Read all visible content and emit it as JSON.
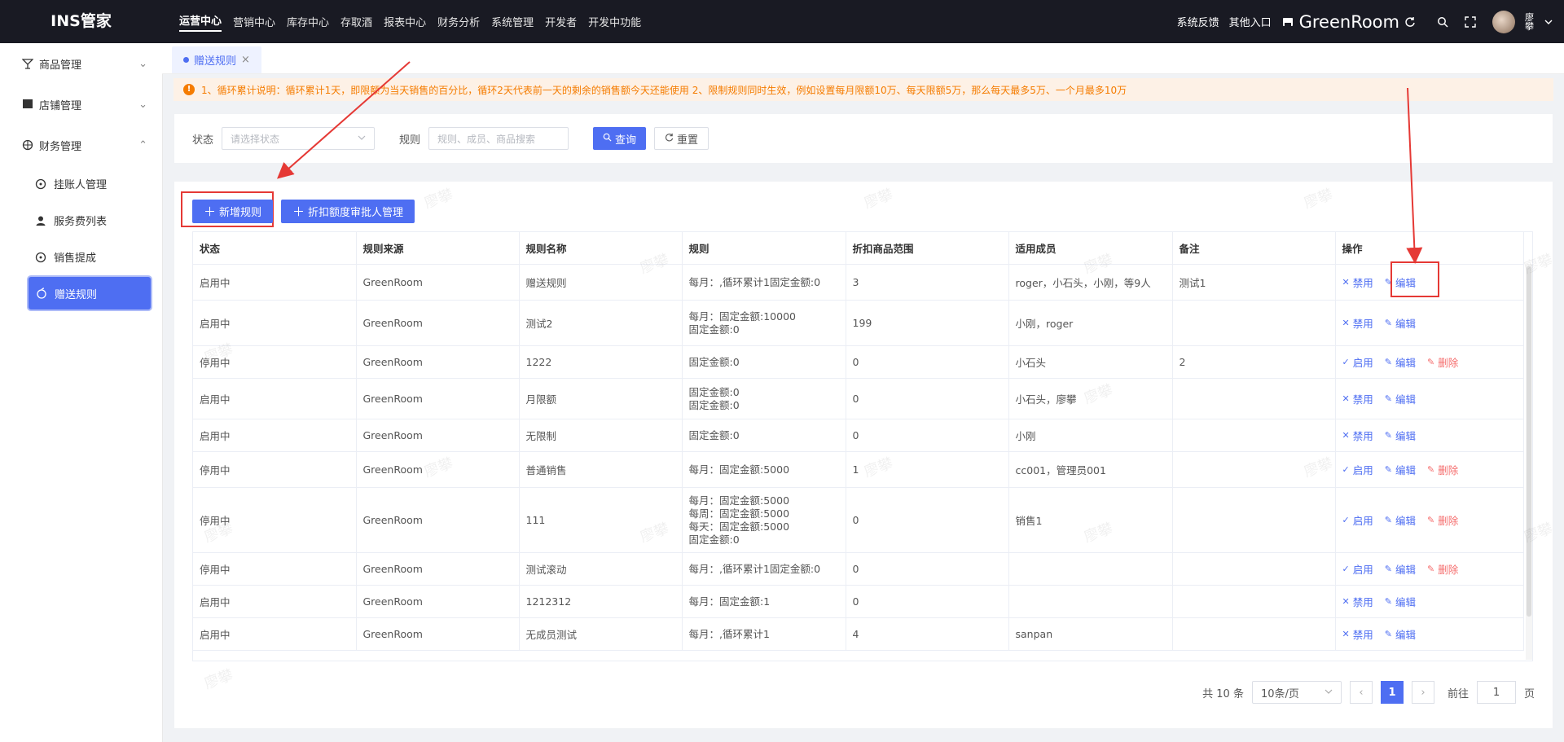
{
  "app": {
    "logo": "INS管家"
  },
  "topnav": [
    "运营中心",
    "营销中心",
    "库存中心",
    "存取酒",
    "报表中心",
    "财务分析",
    "系统管理",
    "开发者",
    "开发中功能"
  ],
  "topnav_active": 0,
  "topright": {
    "feedback": "系统反馈",
    "other_entry": "其他入口",
    "brand": "GreenRoom",
    "username_vertical": "廖攀"
  },
  "sidebar": {
    "items": [
      {
        "label": "商品管理",
        "icon": "cocktail-icon",
        "chevron": "⌄"
      },
      {
        "label": "店铺管理",
        "icon": "store-icon",
        "chevron": "⌄"
      },
      {
        "label": "财务管理",
        "icon": "finance-icon",
        "chevron": "⌃"
      }
    ],
    "sub_items": [
      {
        "label": "挂账人管理",
        "icon": "target-icon"
      },
      {
        "label": "服务费列表",
        "icon": "user-icon"
      },
      {
        "label": "销售提成",
        "icon": "target-icon"
      },
      {
        "label": "赠送规则",
        "icon": "apple-icon",
        "active": true
      }
    ]
  },
  "tabs": [
    {
      "label": "赠送规则",
      "close": "×"
    }
  ],
  "notice": {
    "text": "1、循环累计说明：循环累计1天，即限额为当天销售的百分比，循环2天代表前一天的剩余的销售额今天还能使用 2、限制规则同时生效，例如设置每月限额10万、每天限额5万，那么每天最多5万、一个月最多10万"
  },
  "search": {
    "status_label": "状态",
    "status_placeholder": "请选择状态",
    "rule_label": "规则",
    "rule_placeholder": "规则、成员、商品搜索",
    "query_button": "查询",
    "reset_button": "重置"
  },
  "actions": {
    "add_rule": "新增规则",
    "discount_approver": "折扣额度审批人管理"
  },
  "table": {
    "columns": [
      "状态",
      "规则来源",
      "规则名称",
      "规则",
      "折扣商品范围",
      "适用成员",
      "备注",
      "操作"
    ],
    "rows": [
      {
        "status": "启用中",
        "source": "GreenRoom",
        "name": "赠送规则",
        "rule": [
          "每月：,循环累计1固定金额:0"
        ],
        "scope": "3",
        "members": "roger，小石头，小刚，等9人",
        "note": "测试1",
        "toggle": "禁用",
        "edit": "编辑",
        "delete": ""
      },
      {
        "status": "启用中",
        "source": "GreenRoom",
        "name": "测试2",
        "rule": [
          "每月：固定金额:10000",
          "固定金额:0"
        ],
        "scope": "199",
        "members": "小刚，roger",
        "note": "",
        "toggle": "禁用",
        "edit": "编辑",
        "delete": ""
      },
      {
        "status": "停用中",
        "source": "GreenRoom",
        "name": "1222",
        "rule": [
          "固定金额:0"
        ],
        "scope": "0",
        "members": "小石头",
        "note": "2",
        "toggle": "启用",
        "edit": "编辑",
        "delete": "删除"
      },
      {
        "status": "启用中",
        "source": "GreenRoom",
        "name": "月限额",
        "rule": [
          "固定金额:0",
          "固定金额:0"
        ],
        "scope": "0",
        "members": "小石头，廖攀",
        "note": "",
        "toggle": "禁用",
        "edit": "编辑",
        "delete": ""
      },
      {
        "status": "启用中",
        "source": "GreenRoom",
        "name": "无限制",
        "rule": [
          "固定金额:0"
        ],
        "scope": "0",
        "members": "小刚",
        "note": "",
        "toggle": "禁用",
        "edit": "编辑",
        "delete": ""
      },
      {
        "status": "停用中",
        "source": "GreenRoom",
        "name": "普通销售",
        "rule": [
          "每月：固定金额:5000"
        ],
        "scope": "1",
        "members": "cc001，管理员001",
        "note": "",
        "toggle": "启用",
        "edit": "编辑",
        "delete": "删除"
      },
      {
        "status": "停用中",
        "source": "GreenRoom",
        "name": "111",
        "rule": [
          "每月：固定金额:5000",
          "每周：固定金额:5000",
          "每天：固定金额:5000",
          "固定金额:0"
        ],
        "scope": "0",
        "members": "销售1",
        "note": "",
        "toggle": "启用",
        "edit": "编辑",
        "delete": "删除"
      },
      {
        "status": "停用中",
        "source": "GreenRoom",
        "name": "测试滚动",
        "rule": [
          "每月：,循环累计1固定金额:0"
        ],
        "scope": "0",
        "members": "",
        "note": "",
        "toggle": "启用",
        "edit": "编辑",
        "delete": "删除"
      },
      {
        "status": "启用中",
        "source": "GreenRoom",
        "name": "1212312",
        "rule": [
          "每月：固定金额:1"
        ],
        "scope": "0",
        "members": "",
        "note": "",
        "toggle": "禁用",
        "edit": "编辑",
        "delete": ""
      },
      {
        "status": "启用中",
        "source": "GreenRoom",
        "name": "无成员测试",
        "rule": [
          "每月：,循环累计1"
        ],
        "scope": "4",
        "members": "sanpan",
        "note": "",
        "toggle": "禁用",
        "edit": "编辑",
        "delete": ""
      }
    ]
  },
  "pagination": {
    "total": "共 10 条",
    "page_size": "10条/页",
    "current": "1",
    "goto_label": "前往",
    "goto_value": "1",
    "page_unit": "页"
  },
  "watermark": "廖攀",
  "colors": {
    "primary": "#4e6ef2",
    "nav_bg": "#191a23",
    "notice_text": "#f57c00",
    "danger": "#f56c6c",
    "annotation": "#e53935"
  }
}
